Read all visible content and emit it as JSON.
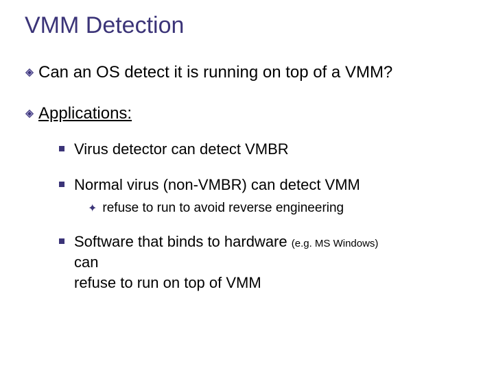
{
  "title": "VMM Detection",
  "bullets": {
    "item1": "Can an OS detect it is running on top of a VMM?",
    "item2": "Applications:",
    "sub1": "Virus detector can detect VMBR",
    "sub2": "Normal virus (non-VMBR) can detect VMM",
    "sub2a": "refuse to run to avoid reverse engineering",
    "sub3_pre": "Software that binds to hardware ",
    "sub3_paren": "(e.g. MS Windows)",
    "sub3_post_line2": "can",
    "sub3_post_line3": "refuse to run on top of VMM"
  }
}
